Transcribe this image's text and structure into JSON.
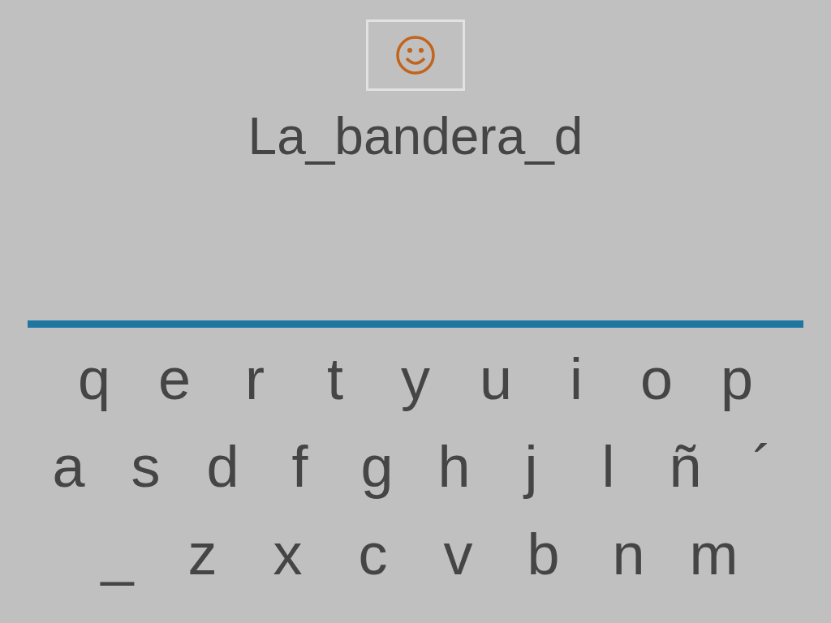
{
  "word": "La_bandera_d",
  "keyboard": [
    [
      "q",
      "e",
      "r",
      "t",
      "y",
      "u",
      "i",
      "o",
      "p"
    ],
    [
      "a",
      "s",
      "d",
      "f",
      "g",
      "h",
      "j",
      "l",
      "ñ",
      "´"
    ],
    [
      "_",
      "z",
      "x",
      "c",
      "v",
      "b",
      "n",
      "m"
    ]
  ]
}
